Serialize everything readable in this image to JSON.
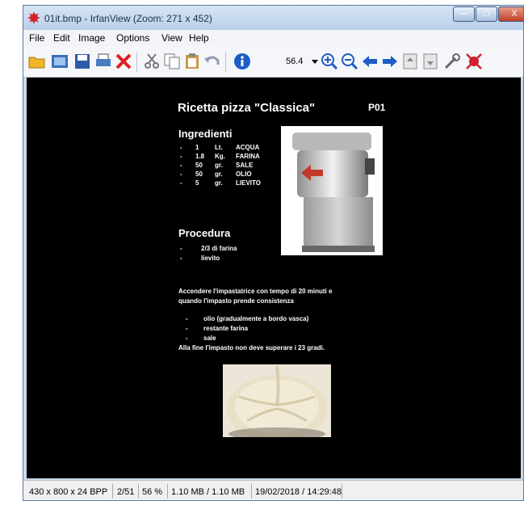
{
  "window": {
    "title": "01it.bmp - IrfanView (Zoom: 271 x 452)",
    "min_glyph": "—",
    "max_glyph": "□",
    "close_glyph": "X"
  },
  "menu": {
    "items": [
      "File",
      "Edit",
      "Image",
      "Options",
      "View",
      "Help"
    ]
  },
  "toolbar": {
    "zoom_value": "56.4",
    "icons": [
      "open-folder-icon",
      "slideshow-icon",
      "save-icon",
      "print-icon",
      "delete-icon",
      "cut-icon",
      "copy-icon",
      "paste-icon",
      "undo-icon",
      "info-icon",
      "zoom-in-icon",
      "zoom-out-icon",
      "previous-icon",
      "next-icon",
      "first-page-icon",
      "last-page-icon",
      "settings-icon",
      "irfanview-icon"
    ]
  },
  "document": {
    "title": "Ricetta pizza \"Classica\"",
    "code": "P01",
    "ingredients_heading": "Ingredienti",
    "ingredients": [
      {
        "dash": "-",
        "qty": "1",
        "unit": "Lt.",
        "name": "ACQUA"
      },
      {
        "dash": "-",
        "qty": "1.8",
        "unit": "Kg.",
        "name": "FARINA"
      },
      {
        "dash": "-",
        "qty": "50",
        "unit": "gr.",
        "name": "SALE"
      },
      {
        "dash": "-",
        "qty": "50",
        "unit": "gr.",
        "name": "OLIO"
      },
      {
        "dash": "-",
        "qty": "5",
        "unit": "gr.",
        "name": "LIEVITO"
      }
    ],
    "procedure_heading": "Procedura",
    "procedure_steps": [
      {
        "dash": "-",
        "text": "2/3 di farina"
      },
      {
        "dash": "-",
        "text": "lievito"
      }
    ],
    "paragraph_line1": "Accendere l'impastatrice con tempo di 20 minuti e",
    "paragraph_line2": "quando l'impasto prende consistenza",
    "sub_steps": [
      {
        "dash": "-",
        "text": "olio (gradualmente a bordo vasca)"
      },
      {
        "dash": "-",
        "text": "restante farina"
      },
      {
        "dash": "-",
        "text": "sale"
      }
    ],
    "final_note": "Alla fine l'impasto non deve superare i 23 gradi."
  },
  "statusbar": {
    "dimensions": "430 x 800 x 24 BPP",
    "page": "2/51",
    "zoom": "56 %",
    "size": "1.10 MB / 1.10 MB",
    "datetime": "19/02/2018 / 14:29:48"
  },
  "colors": {
    "title_bar": "#c9d9ec",
    "viewport_bg": "#000000",
    "close_red": "#c24026",
    "arrow_red": "#c0392b"
  }
}
